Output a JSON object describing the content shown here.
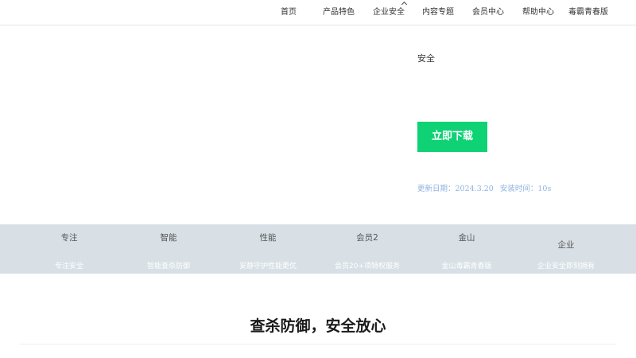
{
  "nav": {
    "items": [
      {
        "label": "首页"
      },
      {
        "label": "产品特色"
      },
      {
        "label": "企业安全"
      },
      {
        "label": "内容专题"
      },
      {
        "label": "会员中心"
      },
      {
        "label": "帮助中心"
      },
      {
        "label": "毒霸青春版"
      }
    ]
  },
  "hero": {
    "label": "安全",
    "download_label": "立即下载",
    "update_date": "更新日期：2024.3.20",
    "install_time": "安装时间：10s"
  },
  "features": [
    {
      "title": "专注",
      "desc": "专注安全"
    },
    {
      "title": "智能",
      "desc": "智能查杀防御"
    },
    {
      "title": "性能",
      "desc": "安静守护性能更优"
    },
    {
      "title": "会员2",
      "desc": "会员20+项特权服务"
    },
    {
      "title": "金山",
      "desc": "金山毒霸青春版"
    },
    {
      "title": "企业",
      "desc": "企业安全即刻拥有"
    }
  ],
  "section": {
    "title": "查杀防御，安全放心"
  },
  "colors": {
    "accent": "#0fd275",
    "meta_text": "#8fb3e0",
    "feature_bg": "#d8e0e5"
  }
}
